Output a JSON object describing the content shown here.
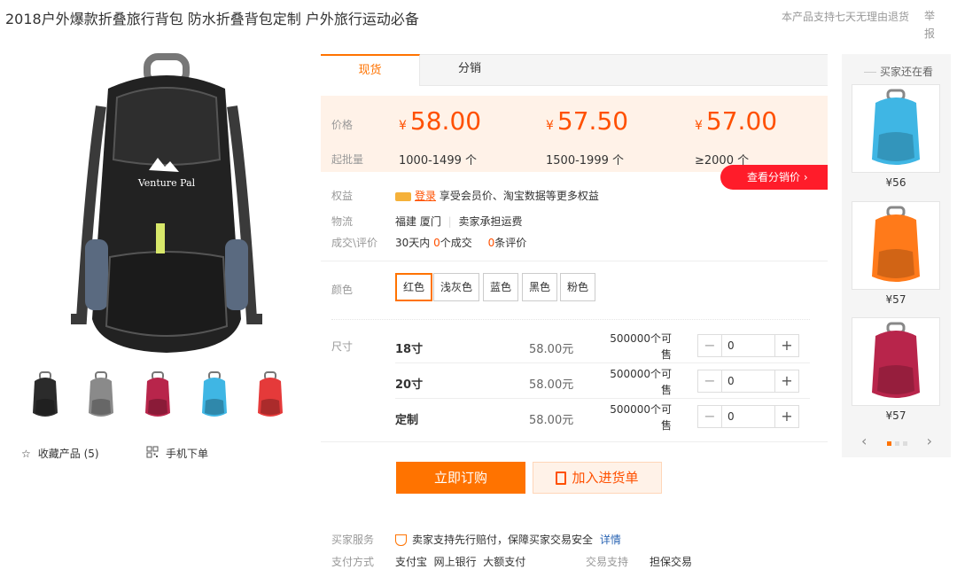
{
  "product_title": "2018户外爆款折叠旅行背包 防水折叠背包定制 户外旅行运动必备",
  "top_note": "本产品支持七天无理由退货",
  "report_label": "举报",
  "main_image_brand": "Venture Pal",
  "thumbnails": [
    {
      "color": "#2b2b2b"
    },
    {
      "color": "#8a8a8a"
    },
    {
      "color": "#b8254b"
    },
    {
      "color": "#3fb6e4"
    },
    {
      "color": "#e53a3a"
    }
  ],
  "actions": {
    "favorite_label": "收藏产品 (5)",
    "mobile_label": "手机下单"
  },
  "tabs": [
    "现货",
    "分销"
  ],
  "pricing": {
    "price_label": "价格",
    "moq_label": "起批量",
    "tiers": [
      {
        "currency": "¥",
        "price": "58.00",
        "range": "1000-1499 个"
      },
      {
        "currency": "¥",
        "price": "57.50",
        "range": "1500-1999 个"
      },
      {
        "currency": "¥",
        "price": "57.00",
        "range": "≥2000 个"
      }
    ],
    "dist_button": "查看分销价 ›"
  },
  "info": {
    "rights_label": "权益",
    "rights_login": "登录",
    "rights_text": "享受会员价、淘宝数据等更多权益",
    "logistics_label": "物流",
    "logistics_origin": "福建 厦门",
    "logistics_text": "卖家承担运费",
    "deals_label": "成交\\评价",
    "deals_prefix": "30天内",
    "deals_count": "0",
    "deals_mid": "个成交",
    "reviews_count": "0",
    "reviews_suffix": "条评价"
  },
  "colors": {
    "label": "颜色",
    "options": [
      "红色",
      "浅灰色",
      "蓝色",
      "黑色",
      "粉色"
    ],
    "selected": "红色"
  },
  "sizes": {
    "label": "尺寸",
    "rows": [
      {
        "name": "18寸",
        "price": "58.00元",
        "stock_line1": "500000个可",
        "stock_line2": "售",
        "qty": "0"
      },
      {
        "name": "20寸",
        "price": "58.00元",
        "stock_line1": "500000个可",
        "stock_line2": "售",
        "qty": "0"
      },
      {
        "name": "定制",
        "price": "58.00元",
        "stock_line1": "500000个可",
        "stock_line2": "售",
        "qty": "0"
      }
    ]
  },
  "buttons": {
    "buy": "立即订购",
    "cart": "加入进货单"
  },
  "service": {
    "buyer_label": "买家服务",
    "buyer_text": "卖家支持先行赔付，保障买家交易安全",
    "buyer_link": "详情",
    "pay_label": "支付方式",
    "pay_methods": "支付宝  网上银行  大额支付",
    "trade_label": "交易支持",
    "trade_value": "担保交易"
  },
  "sidebar": {
    "title": "买家还在看",
    "items": [
      {
        "price": "¥56",
        "color": "#3fb6e4"
      },
      {
        "price": "¥57",
        "color": "#ff7a1a"
      },
      {
        "price": "¥57",
        "color": "#b8254b"
      }
    ]
  },
  "accent": "#ff7300"
}
